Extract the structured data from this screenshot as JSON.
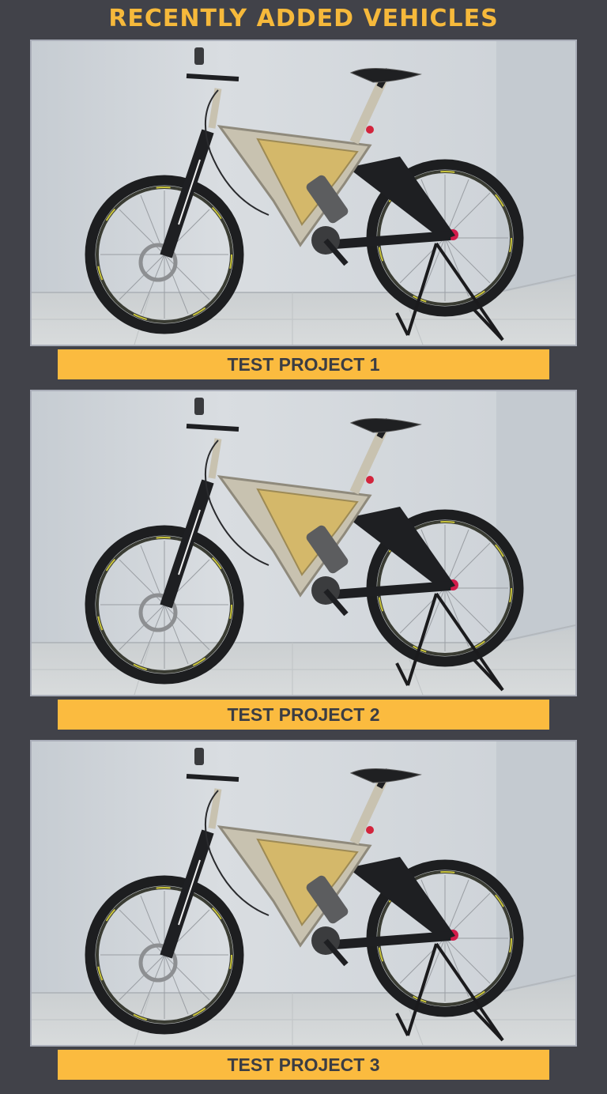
{
  "header": {
    "title": "RECENTLY ADDED VEHICLES"
  },
  "vehicles": [
    {
      "name": "TEST PROJECT 1",
      "image": "electric-mountain-bike-on-stand"
    },
    {
      "name": "TEST PROJECT 2",
      "image": "electric-mountain-bike-on-stand"
    },
    {
      "name": "TEST PROJECT 3",
      "image": "electric-mountain-bike-on-stand"
    }
  ],
  "colors": {
    "background": "#414249",
    "accent": "#fbbb3f",
    "title": "#f6b93b",
    "caption_text": "#3b3d44"
  }
}
